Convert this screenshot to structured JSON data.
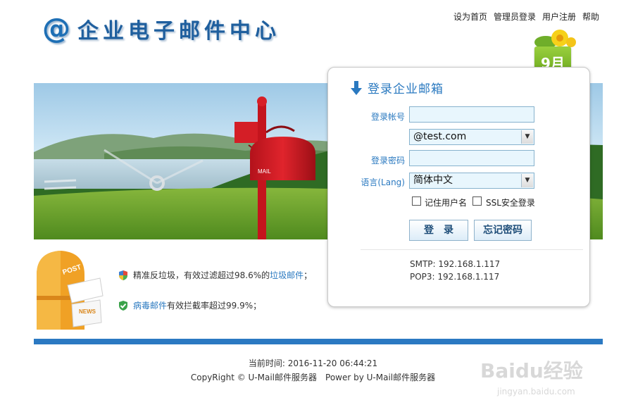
{
  "header": {
    "at_symbol": "@",
    "title": "企业电子邮件中心",
    "links": [
      "设为首页",
      "管理员登录",
      "用户注册",
      "帮助"
    ]
  },
  "calendar": {
    "label": "9月"
  },
  "banner": {
    "mailbox_text": "MAIL"
  },
  "login": {
    "title": "登录企业邮箱",
    "account_label": "登录帐号",
    "account_value": "",
    "domain_value": "@test.com",
    "password_label": "登录密码",
    "password_value": "",
    "language_label": "语言(Lang)",
    "language_value": "简体中文",
    "remember_label": "记住用户名",
    "ssl_label": "SSL安全登录",
    "login_button": "登　录",
    "forgot_button": "忘记密码",
    "smtp": "SMTP: 192.168.1.117",
    "pop3": "POP3: 192.168.1.117"
  },
  "features": {
    "mailbox_words": [
      "POST",
      "NEWS"
    ],
    "spam_prefix": "精准反垃圾，有效过滤超过98.6%的",
    "spam_link": "垃圾邮件",
    "spam_suffix": "；",
    "virus_link": "病毒邮件",
    "virus_suffix": "有效拦截率超过99.9%；"
  },
  "footer": {
    "time": "当前时间: 2016-11-20 06:44:21",
    "copyright": "CopyRight © U-Mail邮件服务器　Power by U-Mail邮件服务器"
  },
  "watermark": {
    "brand": "Baidu经验",
    "url": "jingyan.baidu.com"
  },
  "colors": {
    "accent": "#2a79c0",
    "bar": "#2b79c2",
    "field_bg": "#e8f6fd"
  }
}
